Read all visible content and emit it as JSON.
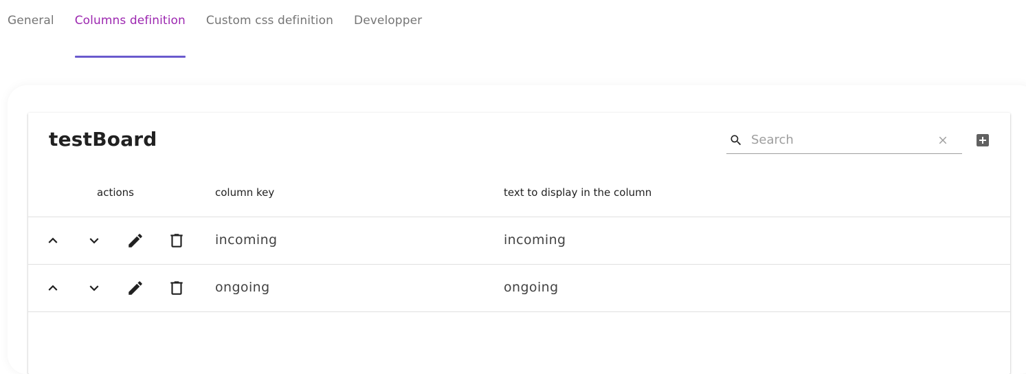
{
  "tabs": [
    {
      "label": "General",
      "active": false
    },
    {
      "label": "Columns definition",
      "active": true
    },
    {
      "label": "Custom css definition",
      "active": false
    },
    {
      "label": "Developper",
      "active": false
    }
  ],
  "card": {
    "title": "testBoard",
    "search": {
      "placeholder": "Search",
      "value": ""
    }
  },
  "table": {
    "headers": {
      "actions": "actions",
      "column_key": "column key",
      "text": "text to display in the column"
    },
    "rows": [
      {
        "column_key": "incoming",
        "text": "incoming"
      },
      {
        "column_key": "ongoing",
        "text": "ongoing"
      }
    ]
  },
  "icons": {
    "search": "search-icon",
    "clear": "close-icon",
    "add": "add-box-icon",
    "move_up": "chevron-up-icon",
    "move_down": "chevron-down-icon",
    "edit": "pencil-icon",
    "delete": "trash-icon"
  },
  "colors": {
    "active_tab_text": "#9c27b0",
    "active_tab_indicator": "#6a5acd",
    "inactive_tab_text": "#757575"
  }
}
